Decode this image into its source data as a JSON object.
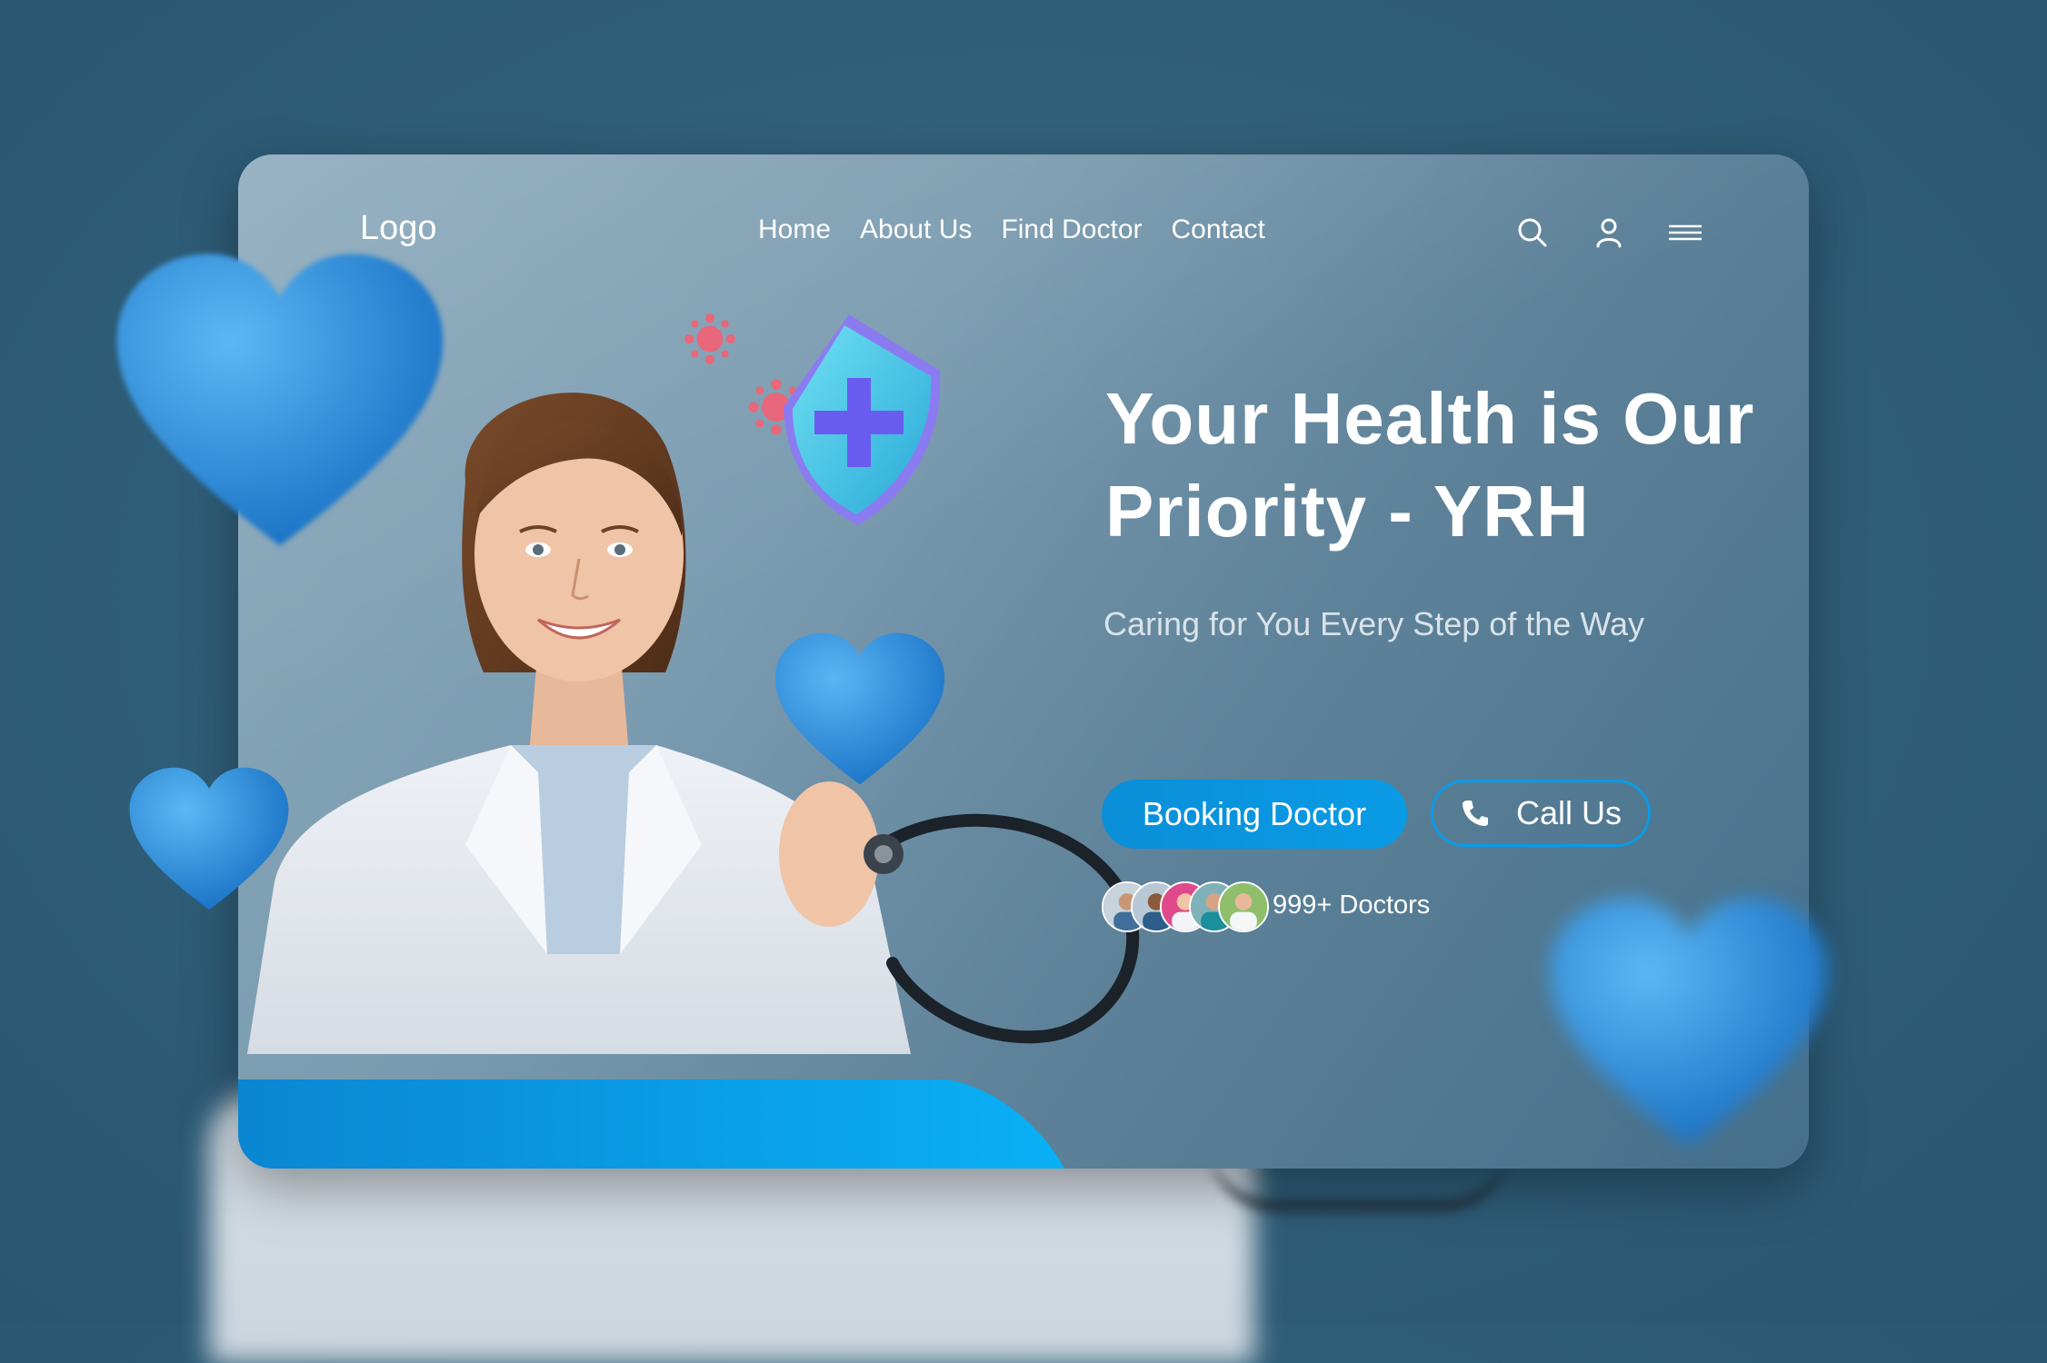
{
  "header": {
    "logo": "Logo",
    "nav": [
      "Home",
      "About Us",
      "Find Doctor",
      "Contact"
    ],
    "icons": [
      "search-icon",
      "user-icon",
      "menu-icon"
    ]
  },
  "hero": {
    "title_line1": "Your Health is Our",
    "title_line2": "Priority - YRH",
    "subtitle": "Caring for You Every Step of the Way",
    "primary_button": "Booking Doctor",
    "secondary_button": "Call Us",
    "secondary_button_icon": "phone-icon",
    "doctors_count": "999+ Doctors"
  },
  "colors": {
    "accent": "#0a9be6",
    "background": "#2f5e78",
    "heart": "#1f86d8"
  }
}
